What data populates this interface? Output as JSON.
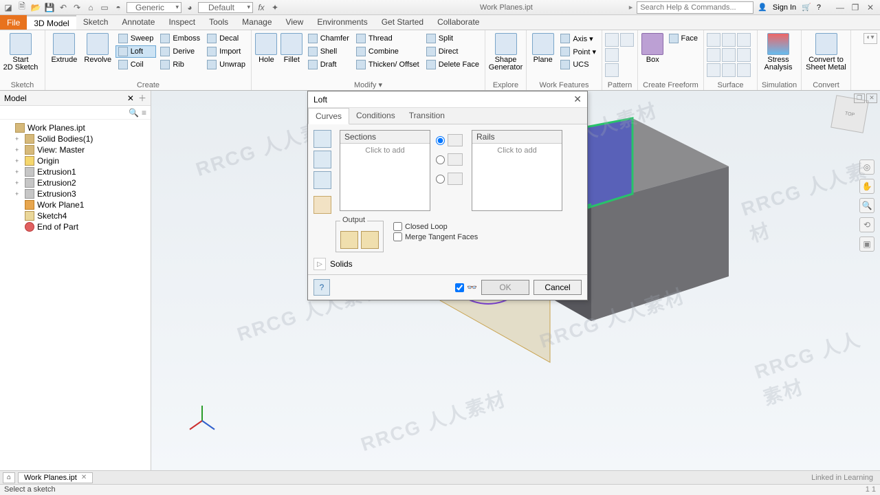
{
  "titlebar": {
    "doc_title": "Work Planes.ipt",
    "search_placeholder": "Search Help & Commands...",
    "sign_in": "Sign In",
    "material_combo": "Generic",
    "appearance_combo": "Default"
  },
  "ribbon_tabs": {
    "file": "File",
    "model": "3D Model",
    "sketch": "Sketch",
    "annotate": "Annotate",
    "inspect": "Inspect",
    "tools": "Tools",
    "manage": "Manage",
    "view": "View",
    "environments": "Environments",
    "get_started": "Get Started",
    "collaborate": "Collaborate"
  },
  "ribbon": {
    "sketch": {
      "start": "Start\n2D Sketch",
      "panel": "Sketch"
    },
    "create": {
      "extrude": "Extrude",
      "revolve": "Revolve",
      "sweep": "Sweep",
      "loft": "Loft",
      "coil": "Coil",
      "emboss": "Emboss",
      "derive": "Derive",
      "rib": "Rib",
      "decal": "Decal",
      "import": "Import",
      "unwrap": "Unwrap",
      "panel": "Create"
    },
    "modify": {
      "hole": "Hole",
      "fillet": "Fillet",
      "chamfer": "Chamfer",
      "shell": "Shell",
      "draft": "Draft",
      "thread": "Thread",
      "combine": "Combine",
      "thicken": "Thicken/ Offset",
      "split": "Split",
      "direct": "Direct",
      "delete_face": "Delete Face",
      "panel": "Modify  ▾"
    },
    "explore": {
      "shape_gen": "Shape\nGenerator",
      "panel": "Explore"
    },
    "work": {
      "plane": "Plane",
      "axis": "Axis ▾",
      "point": "Point ▾",
      "ucs": "UCS",
      "panel": "Work Features"
    },
    "pattern": {
      "panel": "Pattern"
    },
    "freeform": {
      "box": "Box",
      "face": "Face",
      "panel": "Create Freeform"
    },
    "surface": {
      "panel": "Surface"
    },
    "simulation": {
      "stress": "Stress\nAnalysis",
      "panel": "Simulation"
    },
    "convert": {
      "sheet": "Convert to\nSheet Metal",
      "panel": "Convert"
    }
  },
  "browser": {
    "header": "Model",
    "root": "Work Planes.ipt",
    "solid_bodies": "Solid Bodies(1)",
    "view": "View: Master",
    "origin": "Origin",
    "ext1": "Extrusion1",
    "ext2": "Extrusion2",
    "ext3": "Extrusion3",
    "wp1": "Work Plane1",
    "sk4": "Sketch4",
    "eop": "End of Part"
  },
  "dialog": {
    "title": "Loft",
    "tabs": {
      "curves": "Curves",
      "conditions": "Conditions",
      "transition": "Transition"
    },
    "sections": {
      "header": "Sections",
      "hint": "Click to add"
    },
    "rails": {
      "header": "Rails",
      "hint": "Click to add"
    },
    "output_label": "Output",
    "closed_loop": "Closed Loop",
    "merge_tangent": "Merge Tangent Faces",
    "solids": "Solids",
    "ok": "OK",
    "cancel": "Cancel"
  },
  "doctabs": {
    "tab": "Work Planes.ipt",
    "brand": "Linked in Learning"
  },
  "status": {
    "left": "Select a sketch",
    "right": "1   1"
  },
  "watermark": "RRCG 人人素材"
}
